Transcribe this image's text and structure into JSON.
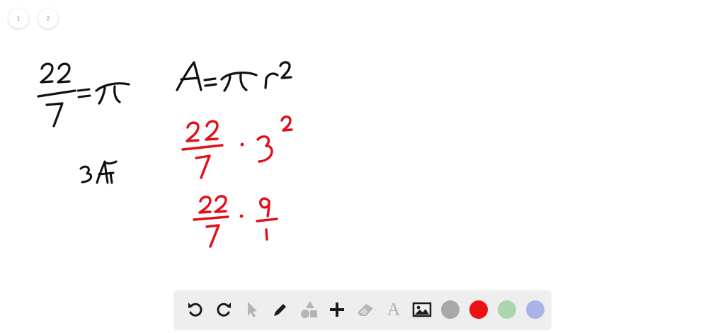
{
  "pages": [
    {
      "label": "1"
    },
    {
      "label": "2"
    }
  ],
  "canvas": {
    "ink_black": "#111111",
    "ink_red": "#e0101a"
  },
  "toolbar": {
    "text_tool_glyph": "A",
    "tools": [
      {
        "icon": "undo-icon",
        "enabled": true
      },
      {
        "icon": "redo-icon",
        "enabled": true
      },
      {
        "icon": "select-pointer-icon",
        "enabled": false
      },
      {
        "icon": "pencil-icon",
        "enabled": true
      },
      {
        "icon": "shapes-icon",
        "enabled": false
      },
      {
        "icon": "plus-icon",
        "enabled": true
      },
      {
        "icon": "eraser-icon",
        "enabled": false
      },
      {
        "icon": "text-icon",
        "enabled": false
      },
      {
        "icon": "image-icon",
        "enabled": true
      }
    ],
    "colors": [
      "#a8a8a8",
      "#ee1111",
      "#abd6ad",
      "#aab3e8"
    ]
  }
}
